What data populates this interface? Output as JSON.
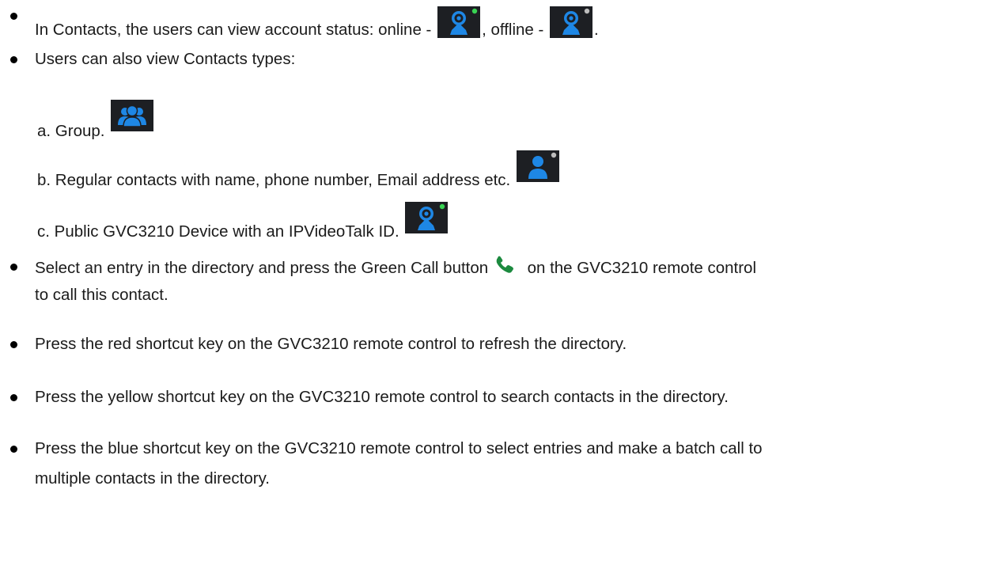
{
  "bullets": {
    "status_pre": "In Contacts, the users can view account status: online - ",
    "status_mid": ", offline - ",
    "status_end": ".",
    "types": "Users can also view Contacts types:",
    "call_pre": "Select an entry in the directory and press the Green Call button ",
    "call_post": " on the GVC3210 remote control",
    "call_cont": "to call this contact.",
    "refresh": "Press the red shortcut key on the GVC3210 remote control to refresh the directory.",
    "search": "Press the yellow shortcut key on the GVC3210 remote control to search contacts in the directory.",
    "batch": "Press the blue shortcut key on the GVC3210 remote control to select entries and make a batch call to",
    "batch_cont": "multiple contacts in the directory."
  },
  "types": {
    "group": "a. Group.",
    "regular": "b. Regular contacts with name, phone number, Email address etc.",
    "public": "c. Public GVC3210 Device with an IPVideoTalk ID."
  },
  "icons": {
    "online": "device-online-icon",
    "offline": "device-offline-icon",
    "group": "group-contacts-icon",
    "regular": "contact-person-icon",
    "device": "public-device-icon",
    "call": "green-call-icon"
  },
  "colors": {
    "icon_bg": "#1d1f23",
    "icon_blue": "#1e87e5",
    "online_dot": "#39d353",
    "offline_dot": "#bdbdbd",
    "call_green": "#1c8a3f"
  }
}
